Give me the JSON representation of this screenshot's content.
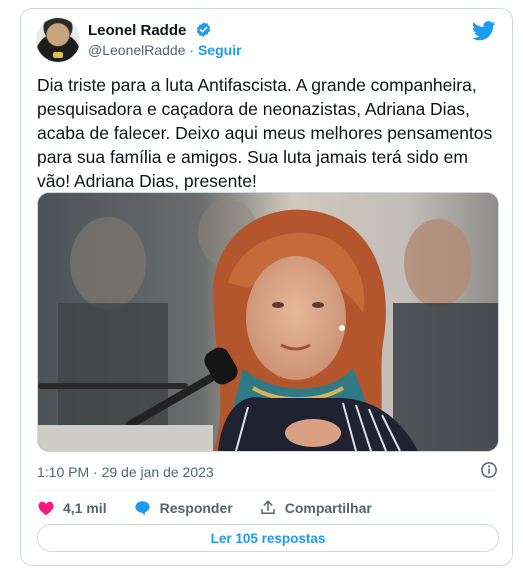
{
  "tweet": {
    "author_name": "Leonel Radde",
    "handle": "@LeonelRadde",
    "separator": "·",
    "follow_label": "Seguir",
    "text": "Dia triste para a luta Antifascista. A grande companheira,\npesquisadora e caçadora de neonazistas, Adriana Dias,\nacaba de falecer. Deixo aqui meus melhores pensamentos\npara sua família e amigos. Sua luta jamais terá sido em\nvão! Adriana Dias, presente!",
    "timestamp": "1:10 PM · 29 de jan de 2023"
  },
  "actions": {
    "likes": "4,1 mil",
    "reply_label": "Responder",
    "share_label": "Compartilhar"
  },
  "read_replies_label": "Ler 105 respostas",
  "colors": {
    "accent": "#1d9bf0",
    "like": "#f91880",
    "muted": "#536471"
  },
  "icons": [
    "verified-badge-icon",
    "twitter-bird-icon",
    "info-icon",
    "heart-icon",
    "reply-bubble-icon",
    "share-icon"
  ]
}
